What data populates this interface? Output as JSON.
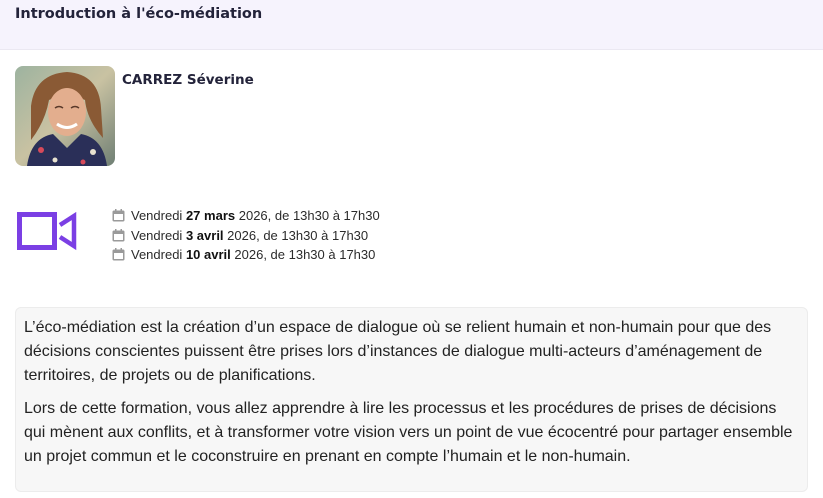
{
  "header": {
    "title": "Introduction à l'éco-médiation"
  },
  "author": {
    "name": "CARREZ Séverine"
  },
  "format_icon": "video-camera-icon",
  "sessions": [
    {
      "day": "Vendredi",
      "date": "27 mars",
      "rest": "2026, de 13h30 à 17h30"
    },
    {
      "day": "Vendredi",
      "date": "3 avril",
      "rest": "2026, de 13h30 à 17h30"
    },
    {
      "day": "Vendredi",
      "date": "10 avril",
      "rest": "2026, de 13h30 à 17h30"
    }
  ],
  "description": {
    "paragraph1": "L’éco-médiation est la création d’un espace de dialogue où se relient humain et non-humain pour que des décisions conscientes puissent être prises lors d’instances de dialogue multi-acteurs d’aménagement de territoires, de projets ou de planifications.",
    "paragraph2": "Lors de cette formation, vous allez apprendre à lire les processus et les procédures de prises de décisions qui mènent aux conflits, et à transformer votre vision vers un point de vue écocentré pour partager ensemble un projet commun et le coconstruire en prenant en compte l’humain et le non-humain."
  },
  "colors": {
    "accent": "#7b3fe4",
    "header_bg": "#f6f3fd"
  }
}
